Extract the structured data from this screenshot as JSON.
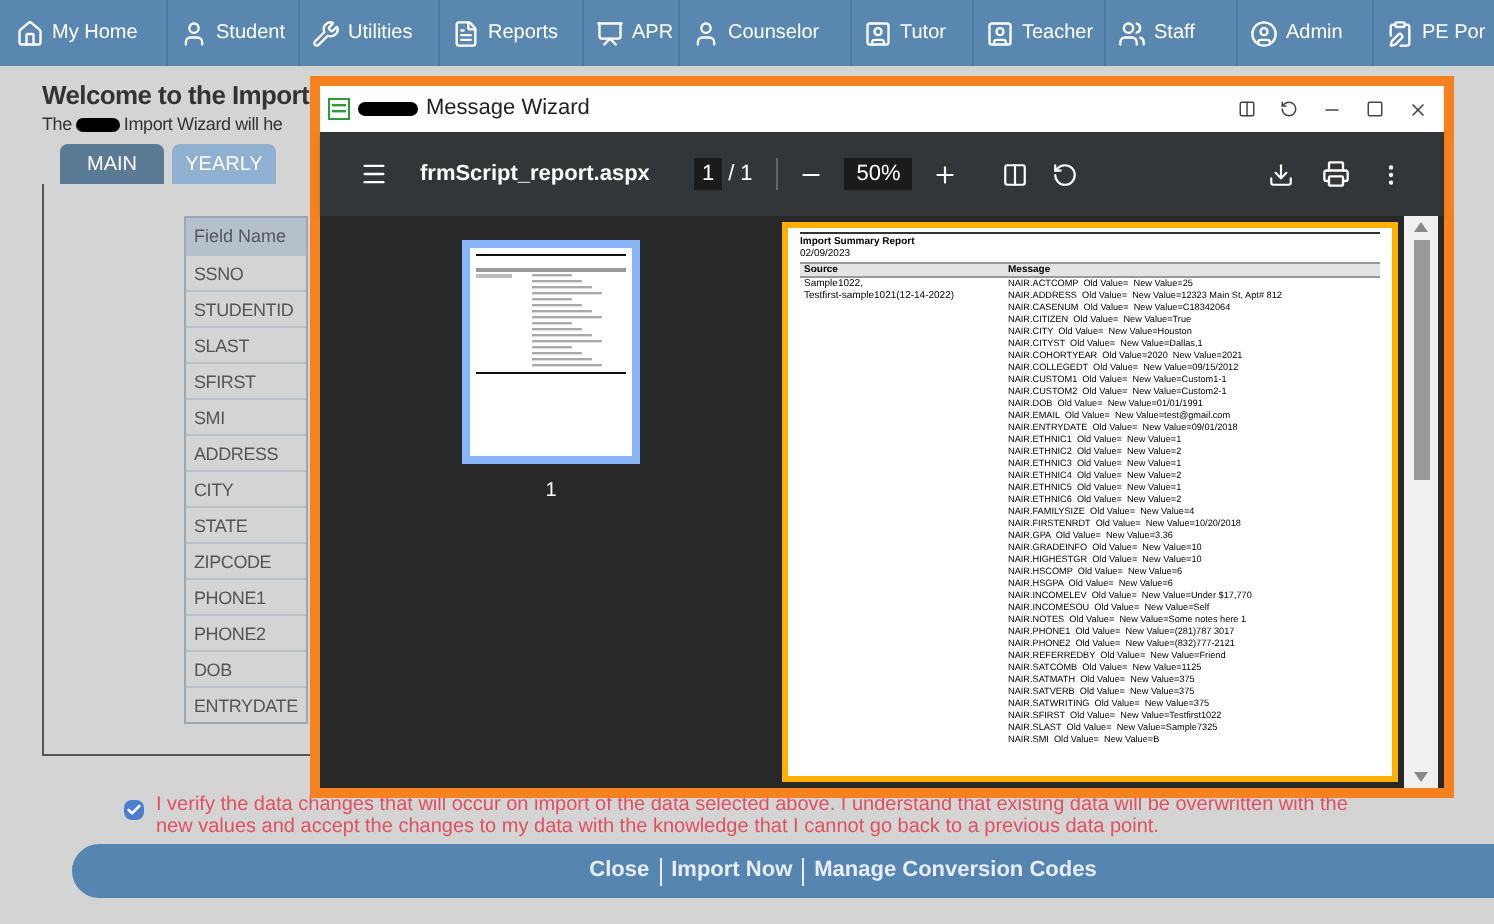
{
  "nav": [
    {
      "label": "My Home"
    },
    {
      "label": "Student"
    },
    {
      "label": "Utilities"
    },
    {
      "label": "Reports"
    },
    {
      "label": "APR"
    },
    {
      "label": "Counselor"
    },
    {
      "label": "Tutor"
    },
    {
      "label": "Teacher"
    },
    {
      "label": "Staff"
    },
    {
      "label": "Admin"
    },
    {
      "label": "PE Por"
    }
  ],
  "page": {
    "title": "Welcome to the Import",
    "subtitle_start": "The",
    "subtitle_end": "Import Wizard will he",
    "tabs": [
      {
        "label": "MAIN",
        "selected": true
      },
      {
        "label": "YEARLY",
        "selected": false
      }
    ],
    "table": {
      "header": "Field Name",
      "rows": [
        "SSNO",
        "STUDENTID",
        "SLAST",
        "SFIRST",
        "SMI",
        "ADDRESS",
        "CITY",
        "STATE",
        "ZIPCODE",
        "PHONE1",
        "PHONE2",
        "DOB",
        "ENTRYDATE"
      ]
    },
    "verify": {
      "checked": true,
      "text": "I verify the data changes that will occur on import of the data selected above. I understand that existing data will be overwritten with the new values and accept the changes to my data with the knowledge that I cannot go back to a previous data point."
    },
    "actions": [
      "Close",
      "Import Now",
      "Manage Conversion Codes"
    ]
  },
  "dialog": {
    "title": "Message Wizard",
    "file": "frmScript_report.aspx",
    "page": "1",
    "pages": "/ 1",
    "zoom": "50%",
    "thumb_label": "1",
    "report": {
      "title": "Import Summary Report",
      "date": "02/09/2023",
      "col_source": "Source",
      "col_message": "Message",
      "source": [
        "Sample1022,",
        "Testfirst-sample1021(12-14-2022)"
      ],
      "messages": [
        "NAIR.ACTCOMP  Old Value=  New Value=25",
        "NAIR.ADDRESS  Old Value=  New Value=12323 Main St, Apt# 812",
        "NAIR.CASENUM  Old Value=  New Value=C18342064",
        "NAIR.CITIZEN  Old Value=  New Value=True",
        "NAIR.CITY  Old Value=  New Value=Houston",
        "NAIR.CITYST  Old Value=  New Value=Dallas,1",
        "NAIR.COHORTYEAR  Old Value=2020  New Value=2021",
        "NAIR.COLLEGEDT  Old Value=  New Value=09/15/2012",
        "NAIR.CUSTOM1  Old Value=  New Value=Custom1-1",
        "NAIR.CUSTOM2  Old Value=  New Value=Custom2-1",
        "NAIR.DOB  Old Value=  New Value=01/01/1991",
        "NAIR.EMAIL  Old Value=  New Value=test@gmail.com",
        "NAIR.ENTRYDATE  Old Value=  New Value=09/01/2018",
        "NAIR.ETHNIC1  Old Value=  New Value=1",
        "NAIR.ETHNIC2  Old Value=  New Value=2",
        "NAIR.ETHNIC3  Old Value=  New Value=1",
        "NAIR.ETHNIC4  Old Value=  New Value=2",
        "NAIR.ETHNIC5  Old Value=  New Value=1",
        "NAIR.ETHNIC6  Old Value=  New Value=2",
        "NAIR.FAMILYSIZE  Old Value=  New Value=4",
        "NAIR.FIRSTENRDT  Old Value=  New Value=10/20/2018",
        "NAIR.GPA  Old Value=  New Value=3.36",
        "NAIR.GRADEINFO  Old Value=  New Value=10",
        "NAIR.HIGHESTGR  Old Value=  New Value=10",
        "NAIR.HSCOMP  Old Value=  New Value=6",
        "NAIR.HSGPA  Old Value=  New Value=6",
        "NAIR.INCOMELEV  Old Value=  New Value=Under $17,770",
        "NAIR.INCOMESOU  Old Value=  New Value=Self",
        "NAIR.NOTES  Old Value=  New Value=Some notes here 1",
        "NAIR.PHONE1  Old Value=  New Value=(281)787 3017",
        "NAIR.PHONE2  Old Value=  New Value=(832)777-2121",
        "NAIR.REFERREDBY  Old Value=  New Value=Friend",
        "NAIR.SATCOMB  Old Value=  New Value=1125",
        "NAIR.SATMATH  Old Value=  New Value=375",
        "NAIR.SATVERB  Old Value=  New Value=375",
        "NAIR.SATWRITING  Old Value=  New Value=375",
        "NAIR.SFIRST  Old Value=  New Value=Testfirst1022",
        "NAIR.SLAST  Old Value=  New Value=Sample7325",
        "NAIR.SMI  Old Value=  New Value=B"
      ]
    }
  }
}
